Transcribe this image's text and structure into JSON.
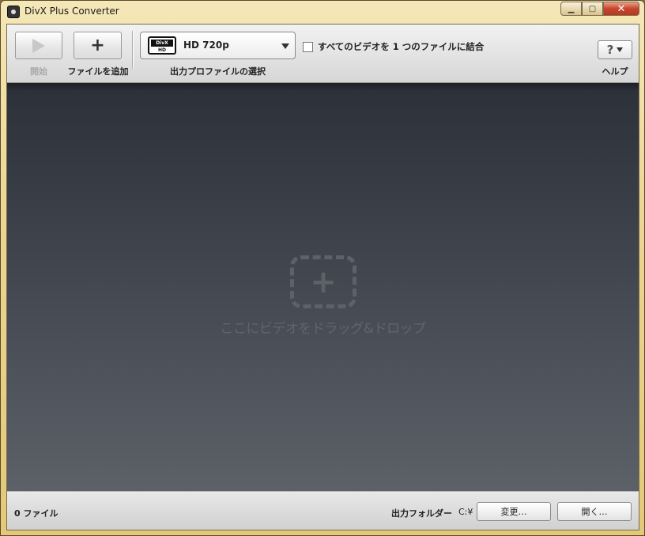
{
  "window": {
    "title": "DivX Plus Converter"
  },
  "toolbar": {
    "start_label": "開始",
    "add_file_label": "ファイルを追加",
    "profile": {
      "value": "HD 720p",
      "label": "出力プロファイルの選択",
      "logo_top": "DivX",
      "logo_bottom": "HD"
    },
    "merge_label": "すべてのビデオを 1 つのファイルに結合",
    "merge_checked": false,
    "help_symbol": "?",
    "help_label": "ヘルプ"
  },
  "dropzone": {
    "text": "ここにビデオをドラッグ&ドロップ"
  },
  "status": {
    "file_count": "0 ファイル",
    "output_folder_label": "出力フォルダー",
    "output_path": "C:¥",
    "change_label": "変更…",
    "open_label": "開く…"
  }
}
